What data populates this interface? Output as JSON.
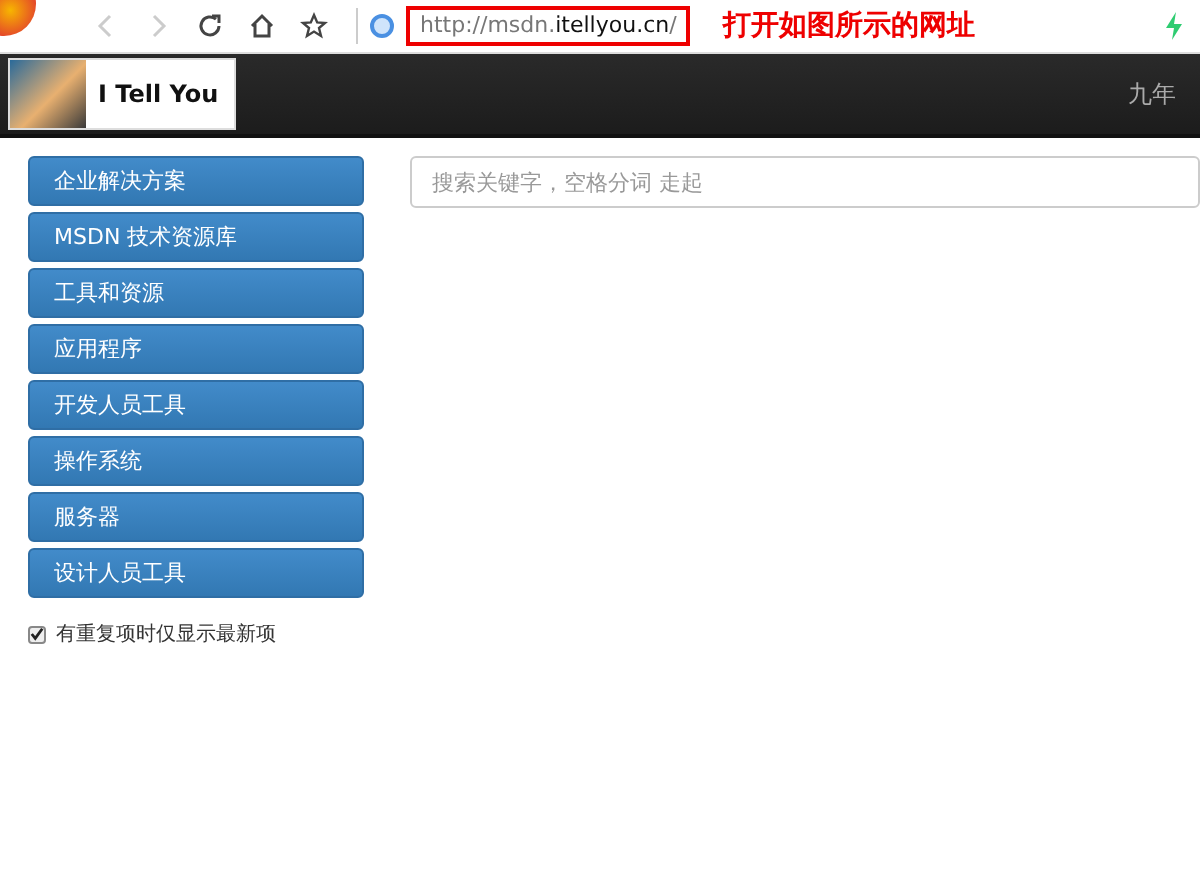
{
  "browser": {
    "url_parts": [
      {
        "text": "http://msdn.",
        "emphasis": false
      },
      {
        "text": "itellyou.cn",
        "emphasis": true
      },
      {
        "text": "/",
        "emphasis": false
      }
    ]
  },
  "annotation": {
    "text": "打开如图所示的网址"
  },
  "site_header": {
    "brand": "I Tell You",
    "tagline": "九年"
  },
  "sidebar": {
    "items": [
      {
        "label": "企业解决方案"
      },
      {
        "label": "MSDN 技术资源库"
      },
      {
        "label": "工具和资源"
      },
      {
        "label": "应用程序"
      },
      {
        "label": "开发人员工具"
      },
      {
        "label": "操作系统"
      },
      {
        "label": "服务器"
      },
      {
        "label": "设计人员工具"
      }
    ],
    "option": {
      "label": "有重复项时仅显示最新项",
      "checked": true
    }
  },
  "search": {
    "placeholder": "搜索关键字，空格分词 走起"
  }
}
